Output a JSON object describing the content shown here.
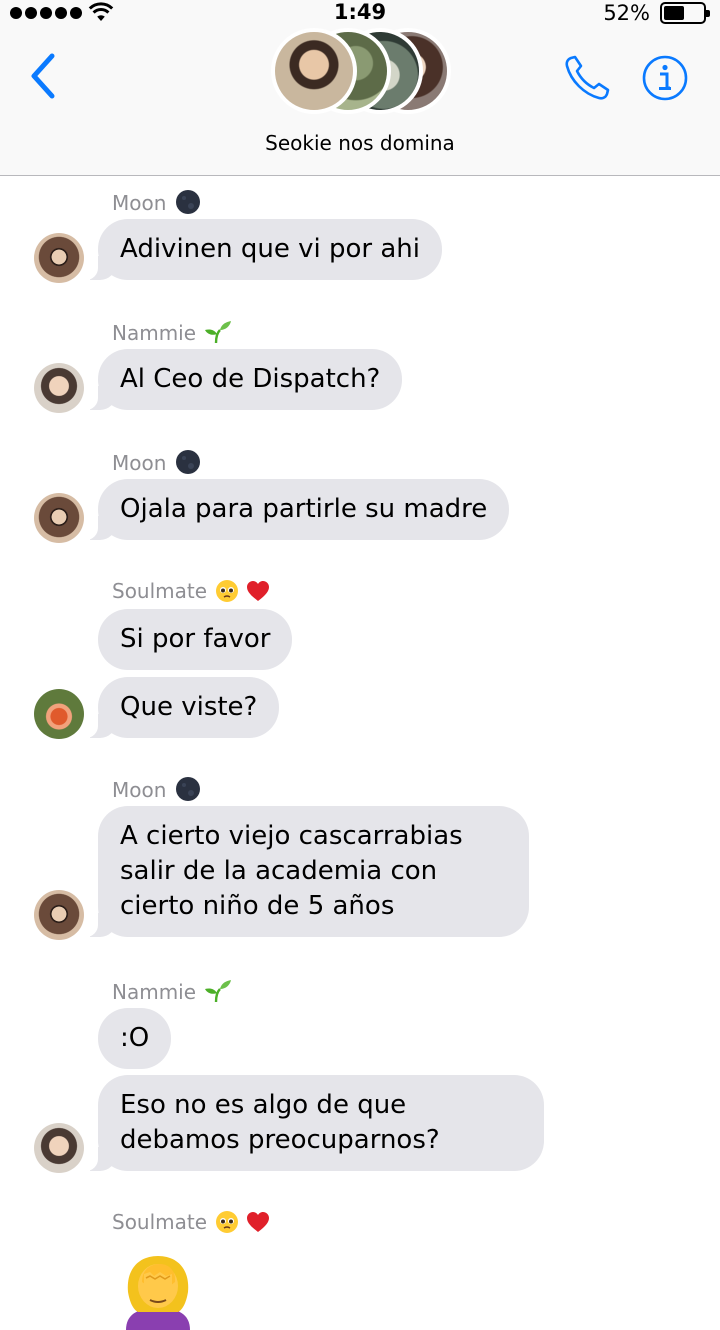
{
  "status_bar": {
    "time": "1:49",
    "battery_percent": "52%",
    "battery_level": 0.52,
    "signal_bars": 5
  },
  "header": {
    "group_name": "Seokie nos domina",
    "icons": {
      "back": "chevron-left-icon",
      "call": "phone-icon",
      "info": "info-icon"
    },
    "accent_color": "#0a7aff"
  },
  "messages": [
    {
      "sender": "Moon",
      "sender_emoji": "new-moon",
      "avatar": "moon",
      "bubbles": [
        "Adivinen que vi por ahi"
      ]
    },
    {
      "sender": "Nammie",
      "sender_emoji": "seedling",
      "avatar": "nammie",
      "bubbles": [
        "Al Ceo de Dispatch?"
      ]
    },
    {
      "sender": "Moon",
      "sender_emoji": "new-moon",
      "avatar": "moon",
      "bubbles": [
        "Ojala para partirle su madre"
      ]
    },
    {
      "sender": "Soulmate",
      "sender_emoji": "pleading-face, red-heart",
      "avatar": "soulmate",
      "bubbles": [
        "Si por favor",
        "Que viste?"
      ]
    },
    {
      "sender": "Moon",
      "sender_emoji": "new-moon",
      "avatar": "moon",
      "bubbles": [
        "A cierto viejo cascarrabias salir de la academia con cierto niño de 5 años"
      ]
    },
    {
      "sender": "Nammie",
      "sender_emoji": "seedling",
      "avatar": "nammie",
      "bubbles": [
        ":O",
        "Eso no es algo de que debamos preocuparnos?"
      ]
    },
    {
      "sender": "Soulmate",
      "sender_emoji": "pleading-face, red-heart",
      "avatar": "soulmate",
      "bubbles": [],
      "emoji_message": "woman-facepalming"
    }
  ],
  "colors": {
    "bubble_incoming": "#e5e5ea",
    "sender_name": "#8e8e93",
    "header_background": "#f9f9f9"
  }
}
